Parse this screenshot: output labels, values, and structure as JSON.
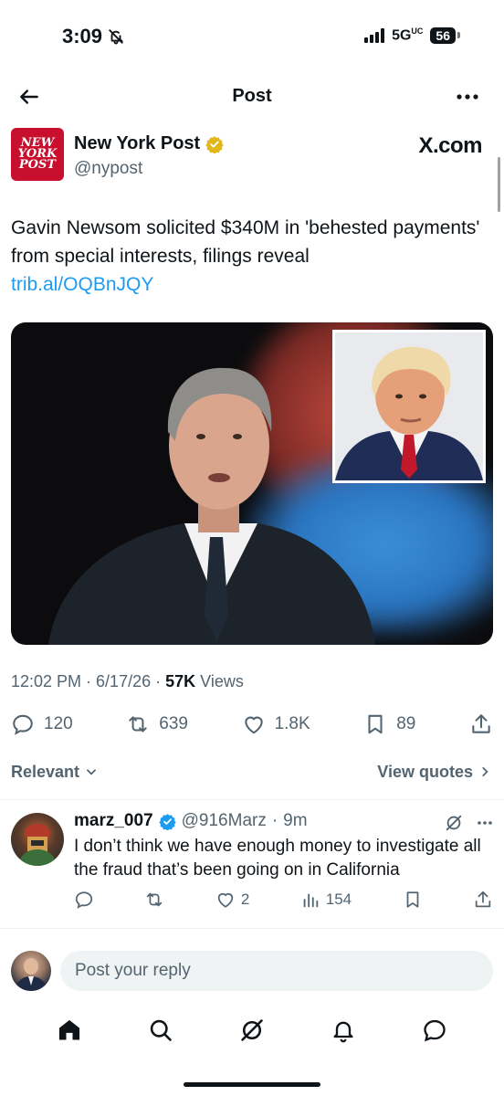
{
  "status_bar": {
    "time": "3:09",
    "network": "5G",
    "network_sub": "UC",
    "battery": "56"
  },
  "header": {
    "title": "Post"
  },
  "author": {
    "avatar_lines": [
      "NEW",
      "YORK",
      "POST"
    ],
    "name": "New York Post",
    "handle": "@nypost",
    "source": "X.com"
  },
  "post": {
    "text": "Gavin Newsom solicited $340M in 'behested payments' from special interests, filings reveal",
    "link": "trib.al/OQBnJQY",
    "time": "12:02 PM",
    "date": "6/17/26",
    "views_count": "57K",
    "views_label": "Views"
  },
  "actions": {
    "replies": "120",
    "reposts": "639",
    "likes": "1.8K",
    "bookmarks": "89"
  },
  "sort": {
    "relevant_label": "Relevant",
    "view_quotes_label": "View quotes"
  },
  "reply": {
    "name": "marz_007",
    "handle": "@916Marz",
    "time": "9m",
    "text": "I don’t think we have enough money to investigate all the fraud that’s been going on in California",
    "likes": "2",
    "views": "154"
  },
  "composer": {
    "placeholder": "Post your reply"
  },
  "colors": {
    "accent": "#1d9bf0",
    "verified_gold": "#e2b719",
    "verified_blue": "#1d9bf0",
    "secondary_text": "#536471",
    "nyp_red": "#c8102e"
  }
}
